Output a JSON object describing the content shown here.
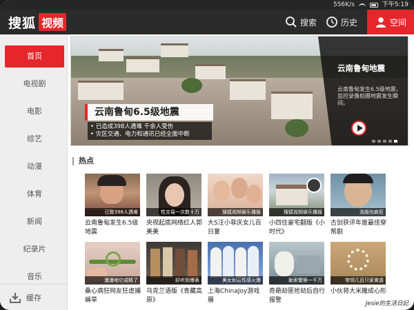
{
  "statusbar": {
    "speed": "556K/s",
    "time": "下午5:19"
  },
  "topbar": {
    "logo_text": "搜狐",
    "logo_badge": "视频",
    "search_label": "搜索",
    "history_label": "历史",
    "space_label": "空间"
  },
  "sidebar": {
    "items": [
      {
        "label": "首页",
        "active": true
      },
      {
        "label": "电视剧"
      },
      {
        "label": "电影"
      },
      {
        "label": "综艺"
      },
      {
        "label": "动漫"
      },
      {
        "label": "体育"
      },
      {
        "label": "新闻"
      },
      {
        "label": "纪录片"
      },
      {
        "label": "音乐"
      }
    ],
    "cache_label": "缓存"
  },
  "banner": {
    "title": "云南鲁甸6.5级地震",
    "bullets": [
      "• 已造成398人遇难 千余人受伤",
      "• 灾区交通、电力和通讯已经全面中断"
    ],
    "side_title": "云南鲁甸地震",
    "side_desc": "云南鲁甸发生6.5级地震，监控录像拍摄地震发生瞬间。"
  },
  "hot": {
    "section_title": "热点",
    "videos": [
      {
        "caption": "已致398人遇难",
        "title": "云南鲁甸发生6.5级地震"
      },
      {
        "caption": "性交易一次数十万",
        "title": "央视起底网络红人郭美美"
      },
      {
        "caption": "搜狐视频娱乐播报",
        "title": "大S汪小菲庆女儿百日宴"
      },
      {
        "caption": "搜狐视频娱乐播报",
        "title": "小四住豪宅翻版《小时代》"
      },
      {
        "caption": "泡面也疯狂",
        "title": "古剑获评年度最佳穿帮剧"
      },
      {
        "caption": "瀑瀑地它成精了",
        "title": "桑心病狂网友狂虐捕蝇草"
      },
      {
        "caption": "好听到爆表",
        "title": "乌克兰语版《青藏高原》"
      },
      {
        "caption": "美女如云性感火爆",
        "title": "上海ChinaJoy游戏展"
      },
      {
        "caption": "勒索警察一千万",
        "title": "奇葩劫匪抢劫后自行报警"
      },
      {
        "caption": "带领几百只家禽逐",
        "title": "小伙将大米撒成心形"
      }
    ]
  },
  "watermark": "Jesie的生活日記"
}
